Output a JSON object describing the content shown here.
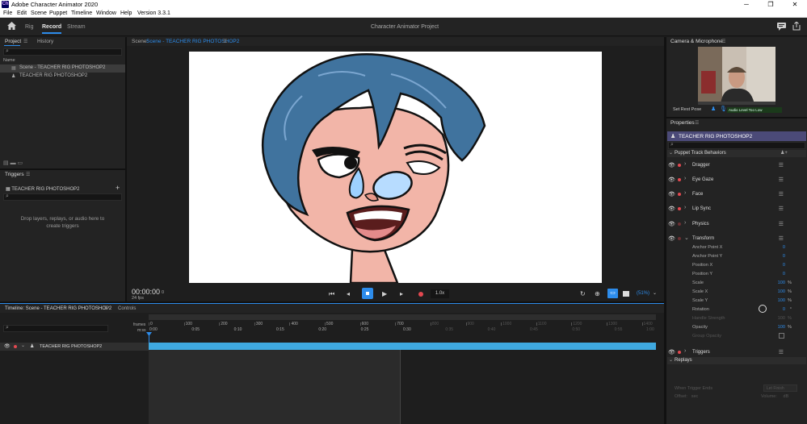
{
  "window": {
    "title": "Adobe Character Animator 2020",
    "app_icon": "Ch"
  },
  "menu": [
    "File",
    "Edit",
    "Scene",
    "Puppet",
    "Timeline",
    "Window",
    "Help",
    "Version 3.3.1"
  ],
  "modes": [
    {
      "label": "Rig"
    },
    {
      "label": "Record"
    },
    {
      "label": "Stream"
    }
  ],
  "project_title": "Character Animator Project",
  "project_panel": {
    "tabs": [
      "Project",
      "History"
    ],
    "column": "Name",
    "items": [
      "Scene - TEACHER RIG PHOTOSHOP2",
      "TEACHER RIG PHOTOSHOP2"
    ]
  },
  "triggers_panel": {
    "title": "Triggers",
    "puppet": "TEACHER RIG PHOTOSHOP2",
    "drop_hint_1": "Drop layers, replays, or audio here to",
    "drop_hint_2": "create triggers"
  },
  "scene_panel": {
    "label": "Scene:",
    "scene_name": "Scene - TEACHER RIG PHOTOSHOP2",
    "timecode": "00:00:00",
    "frame": "0",
    "fps": "24 fps",
    "speed": "1.0x",
    "zoom": "(51%)"
  },
  "camera_panel": {
    "title": "Camera & Microphone",
    "set_rest_pose": "Set Rest Pose",
    "audio_level": "Audio Level Too Low"
  },
  "properties_panel": {
    "title": "Properties",
    "puppet": "TEACHER RIG PHOTOSHOP2",
    "section": "Puppet Track Behaviors",
    "behaviors": [
      "Dragger",
      "Eye Gaze",
      "Face",
      "Lip Sync",
      "Physics",
      "Transform"
    ],
    "transform_params": [
      {
        "label": "Anchor Point X",
        "value": "0",
        "unit": ""
      },
      {
        "label": "Anchor Point Y",
        "value": "0",
        "unit": ""
      },
      {
        "label": "Position X",
        "value": "0",
        "unit": ""
      },
      {
        "label": "Position Y",
        "value": "0",
        "unit": ""
      },
      {
        "label": "Scale",
        "value": "100",
        "unit": "%"
      },
      {
        "label": "Scale X",
        "value": "100",
        "unit": "%"
      },
      {
        "label": "Scale Y",
        "value": "100",
        "unit": "%"
      },
      {
        "label": "Rotation",
        "value": "0",
        "unit": "°"
      },
      {
        "label": "Handle Strength",
        "value": "100",
        "unit": "%"
      },
      {
        "label": "Opacity",
        "value": "100",
        "unit": "%"
      },
      {
        "label": "Group Opacity",
        "value": "",
        "unit": ""
      }
    ],
    "triggers": "Triggers",
    "replays": "Replays",
    "when_trigger_ends": "When Trigger Ends",
    "let_finish": "Let Finish",
    "offset": "Offset",
    "offset_unit": "sec",
    "volume": "Volume",
    "volume_unit": "dB"
  },
  "timeline": {
    "title": "Timeline: Scene - TEACHER RIG PHOTOSHOP2",
    "controls": "Controls",
    "frames_label": "frames",
    "mss_label": "m:ss",
    "frame_ticks": [
      "0",
      "100",
      "200",
      "300",
      "400",
      "500",
      "600",
      "700",
      "800",
      "900",
      "1000",
      "1100",
      "1200",
      "1300",
      "1400"
    ],
    "time_ticks": [
      "0:00",
      "0:05",
      "0:10",
      "0:15",
      "0:20",
      "0:25",
      "0:30",
      "0:35",
      "0:40",
      "0:45",
      "0:50",
      "0:55",
      "1:00"
    ],
    "track": "TEACHER RIG PHOTOSHOP2"
  },
  "colors": {
    "accent": "#2d8ceb",
    "track": "#3fa9e0",
    "record": "#e34850",
    "puppet_sel": "#4b4a78"
  }
}
